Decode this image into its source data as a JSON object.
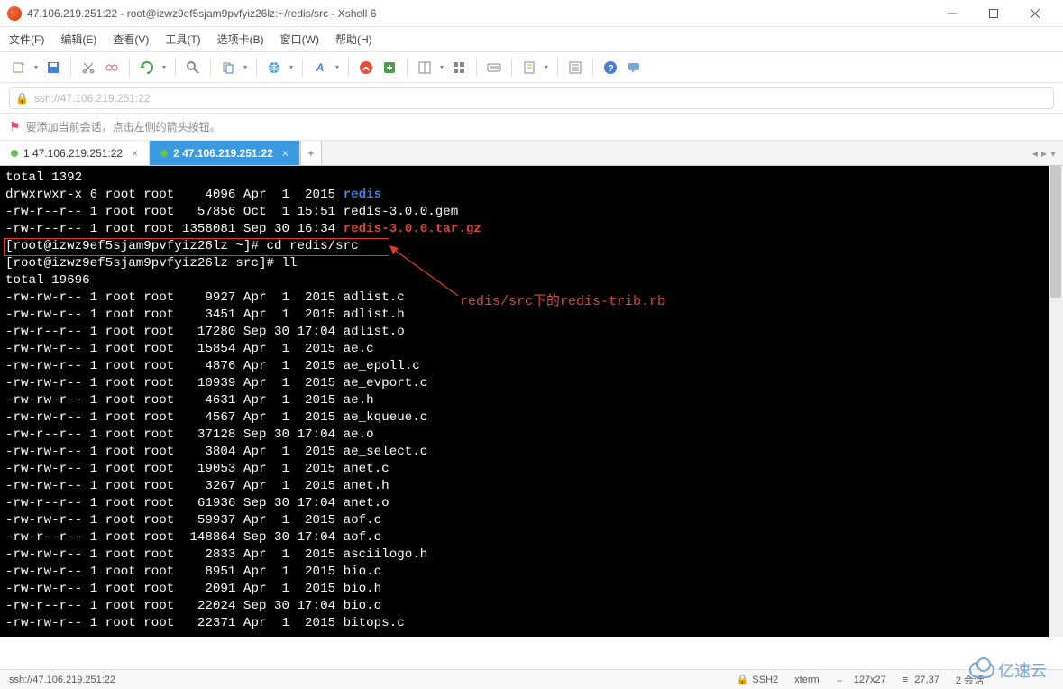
{
  "window": {
    "title": "47.106.219.251:22 - root@izwz9ef5sjam9pvfyiz26lz:~/redis/src - Xshell 6"
  },
  "menu": {
    "file": "文件(F)",
    "edit": "编辑(E)",
    "view": "查看(V)",
    "tools": "工具(T)",
    "tabs": "选项卡(B)",
    "window": "窗口(W)",
    "help": "帮助(H)"
  },
  "address": {
    "value": "ssh://47.106.219.251:22"
  },
  "hint": {
    "text": "要添加当前会话，点击左侧的箭头按钮。"
  },
  "tabs": {
    "inactive": "1 47.106.219.251:22",
    "active": "2 47.106.219.251:22",
    "add": "+"
  },
  "terminal": {
    "l0": "total 1392",
    "l1a": "drwxrwxr-x 6 root root    4096 Apr  1  2015 ",
    "l1b": "redis",
    "l2": "-rw-r--r-- 1 root root   57856 Oct  1 15:51 redis-3.0.0.gem",
    "l3a": "-rw-r--r-- 1 root root 1358081 Sep 30 16:34 ",
    "l3b": "redis-3.0.0.tar.gz",
    "l4": "[root@izwz9ef5sjam9pvfyiz26lz ~]# cd redis/src",
    "l5": "[root@izwz9ef5sjam9pvfyiz26lz src]# ll",
    "l6": "total 19696",
    "f0": "-rw-rw-r-- 1 root root    9927 Apr  1  2015 adlist.c",
    "f1": "-rw-rw-r-- 1 root root    3451 Apr  1  2015 adlist.h",
    "f2": "-rw-r--r-- 1 root root   17280 Sep 30 17:04 adlist.o",
    "f3": "-rw-rw-r-- 1 root root   15854 Apr  1  2015 ae.c",
    "f4": "-rw-rw-r-- 1 root root    4876 Apr  1  2015 ae_epoll.c",
    "f5": "-rw-rw-r-- 1 root root   10939 Apr  1  2015 ae_evport.c",
    "f6": "-rw-rw-r-- 1 root root    4631 Apr  1  2015 ae.h",
    "f7": "-rw-rw-r-- 1 root root    4567 Apr  1  2015 ae_kqueue.c",
    "f8": "-rw-r--r-- 1 root root   37128 Sep 30 17:04 ae.o",
    "f9": "-rw-rw-r-- 1 root root    3804 Apr  1  2015 ae_select.c",
    "f10": "-rw-rw-r-- 1 root root   19053 Apr  1  2015 anet.c",
    "f11": "-rw-rw-r-- 1 root root    3267 Apr  1  2015 anet.h",
    "f12": "-rw-r--r-- 1 root root   61936 Sep 30 17:04 anet.o",
    "f13": "-rw-rw-r-- 1 root root   59937 Apr  1  2015 aof.c",
    "f14": "-rw-r--r-- 1 root root  148864 Sep 30 17:04 aof.o",
    "f15": "-rw-rw-r-- 1 root root    2833 Apr  1  2015 asciilogo.h",
    "f16": "-rw-rw-r-- 1 root root    8951 Apr  1  2015 bio.c",
    "f17": "-rw-rw-r-- 1 root root    2091 Apr  1  2015 bio.h",
    "f18": "-rw-r--r-- 1 root root   22024 Sep 30 17:04 bio.o",
    "f19": "-rw-rw-r-- 1 root root   22371 Apr  1  2015 bitops.c"
  },
  "annotation": {
    "text": "redis/src下的redis-trib.rb"
  },
  "status": {
    "addr": "ssh://47.106.219.251:22",
    "proto": "SSH2",
    "term": "xterm",
    "size": "127x27",
    "pos": "27,37",
    "sessions": "2 会话",
    "logo": "亿速云"
  }
}
